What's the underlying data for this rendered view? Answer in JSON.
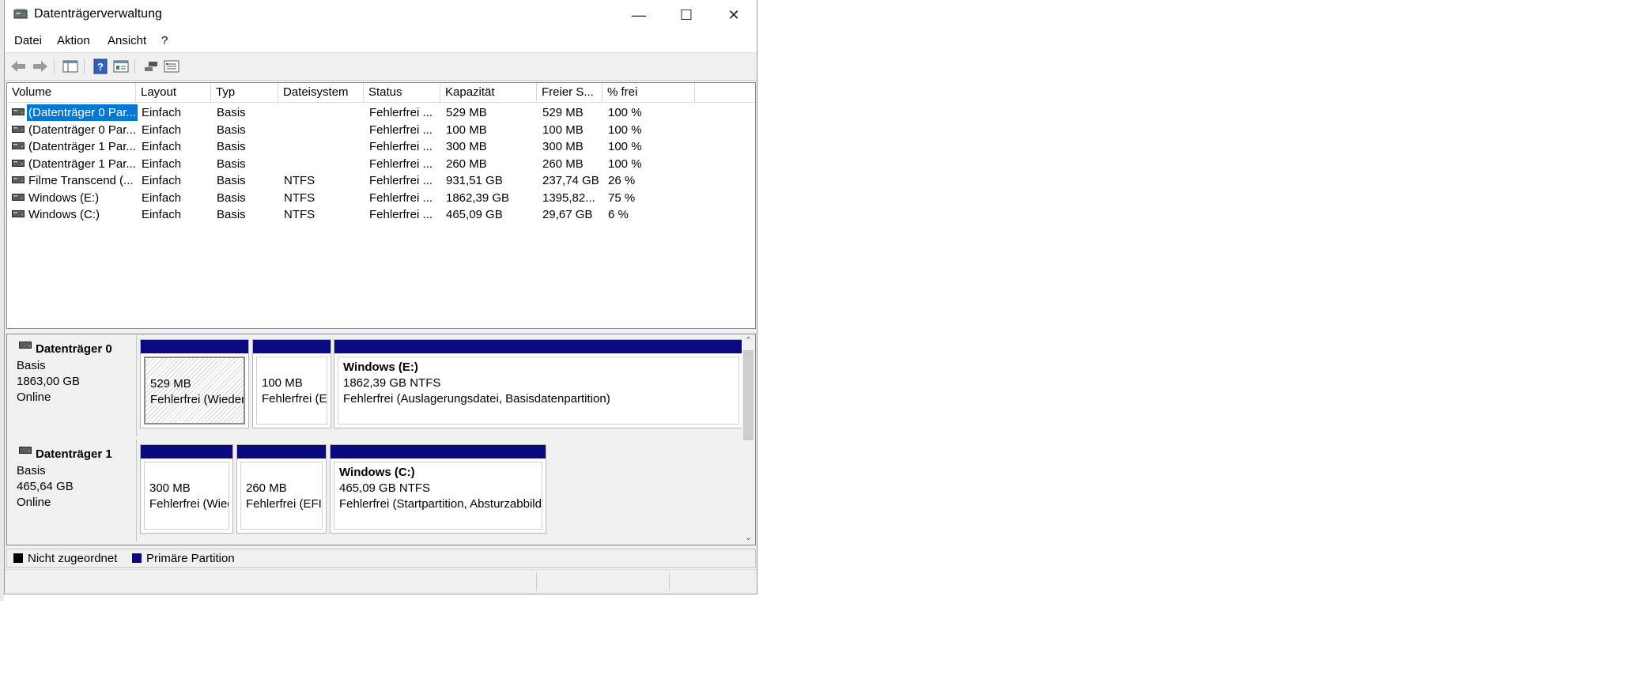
{
  "window": {
    "title": "Datenträgerverwaltung",
    "controls": {
      "minimize": "—",
      "maximize": "☐",
      "close": "✕"
    }
  },
  "menu": {
    "items": [
      "Datei",
      "Aktion",
      "Ansicht",
      "?"
    ]
  },
  "toolbar": {
    "buttons": [
      "back-arrow-icon",
      "forward-arrow-icon",
      "console-tree-icon",
      "help-icon",
      "properties-icon",
      "connect-icon",
      "settings-icon"
    ]
  },
  "volume_list": {
    "columns": [
      "Volume",
      "Layout",
      "Typ",
      "Dateisystem",
      "Status",
      "Kapazität",
      "Freier S...",
      "% frei"
    ],
    "rows": [
      {
        "volume": "(Datenträger 0 Par...",
        "layout": "Einfach",
        "typ": "Basis",
        "dateisystem": "",
        "status": "Fehlerfrei ...",
        "kapazitaet": "529 MB",
        "frei": "529 MB",
        "prozent": "100 %"
      },
      {
        "volume": "(Datenträger 0 Par...",
        "layout": "Einfach",
        "typ": "Basis",
        "dateisystem": "",
        "status": "Fehlerfrei ...",
        "kapazitaet": "100 MB",
        "frei": "100 MB",
        "prozent": "100 %"
      },
      {
        "volume": "(Datenträger 1 Par...",
        "layout": "Einfach",
        "typ": "Basis",
        "dateisystem": "",
        "status": "Fehlerfrei ...",
        "kapazitaet": "300 MB",
        "frei": "300 MB",
        "prozent": "100 %"
      },
      {
        "volume": "(Datenträger 1 Par...",
        "layout": "Einfach",
        "typ": "Basis",
        "dateisystem": "",
        "status": "Fehlerfrei ...",
        "kapazitaet": "260 MB",
        "frei": "260 MB",
        "prozent": "100 %"
      },
      {
        "volume": "Filme Transcend (...",
        "layout": "Einfach",
        "typ": "Basis",
        "dateisystem": "NTFS",
        "status": "Fehlerfrei ...",
        "kapazitaet": "931,51 GB",
        "frei": "237,74 GB",
        "prozent": "26 %"
      },
      {
        "volume": "Windows  (E:)",
        "layout": "Einfach",
        "typ": "Basis",
        "dateisystem": "NTFS",
        "status": "Fehlerfrei ...",
        "kapazitaet": "1862,39 GB",
        "frei": "1395,82...",
        "prozent": "75 %"
      },
      {
        "volume": "Windows (C:)",
        "layout": "Einfach",
        "typ": "Basis",
        "dateisystem": "NTFS",
        "status": "Fehlerfrei ...",
        "kapazitaet": "465,09 GB",
        "frei": "29,67 GB",
        "prozent": "6 %"
      }
    ]
  },
  "disks": [
    {
      "name": "Datenträger 0",
      "type": "Basis",
      "size": "1863,00 GB",
      "state": "Online",
      "partitions": [
        {
          "title": "",
          "size": "529 MB",
          "status": "Fehlerfrei (Wiederherstel",
          "selected": true
        },
        {
          "title": "",
          "size": "100 MB",
          "status": "Fehlerfrei (EFI-Sys",
          "selected": false
        },
        {
          "title": "Windows   (E:)",
          "size": "1862,39 GB NTFS",
          "status": "Fehlerfrei (Auslagerungsdatei, Basisdatenpartition)",
          "selected": false
        }
      ]
    },
    {
      "name": "Datenträger 1",
      "type": "Basis",
      "size": "465,64 GB",
      "state": "Online",
      "partitions": [
        {
          "title": "",
          "size": "300 MB",
          "status": "Fehlerfrei (Wiederher",
          "selected": false
        },
        {
          "title": "",
          "size": "260 MB",
          "status": "Fehlerfrei (EFI-Syster",
          "selected": false
        },
        {
          "title": "Windows  (C:)",
          "size": "465,09 GB NTFS",
          "status": "Fehlerfrei (Startpartition, Absturzabbild, Basisdatenp",
          "selected": false
        }
      ]
    }
  ],
  "legend": [
    {
      "label": "Nicht zugeordnet",
      "color": "#000000"
    },
    {
      "label": "Primäre Partition",
      "color": "#0a0a80"
    }
  ],
  "colors": {
    "selection": "#0078d7",
    "partition_header": "#0a0a80"
  }
}
